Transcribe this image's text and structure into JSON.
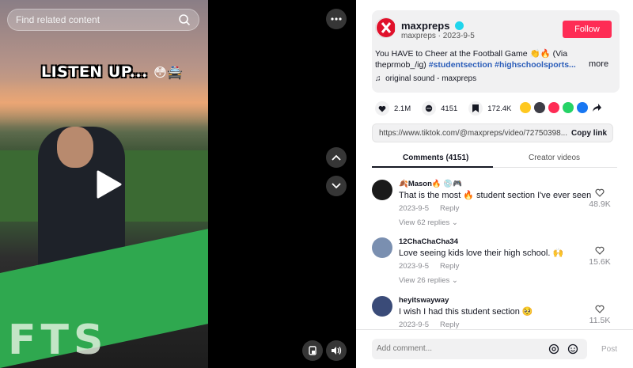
{
  "video": {
    "search_placeholder": "Find related content",
    "caption": "LISTEN UP...",
    "caption_emojis": "😳🚔",
    "banner_text": "FTS"
  },
  "author": {
    "handle": "maxpreps",
    "subline": "maxpreps · 2023-9-5",
    "follow_label": "Follow"
  },
  "post": {
    "text_start": "You HAVE to Cheer at the Football Game 👏🔥 (Via ",
    "text_source": "theprmob_/ig) ",
    "tags": "#studentsection #highschoolsports...",
    "more_label": "more",
    "sound": "original sound - maxpreps"
  },
  "stats": {
    "likes": "2.1M",
    "comments": "4151",
    "saves": "172.4K"
  },
  "share": {
    "url": "https://www.tiktok.com/@maxpreps/video/72750398...",
    "copy_label": "Copy link"
  },
  "tabs": {
    "comments": "Comments (4151)",
    "creator": "Creator videos"
  },
  "comments": [
    {
      "name": "🍂Mason🔥 💿🎮",
      "text": "That is the most 🔥 student section I've ever seen",
      "date": "2023-9-5",
      "reply": "Reply",
      "views": "View 62 replies ⌄",
      "likes": "48.9K"
    },
    {
      "name": "12ChaChaCha34",
      "text": "Love seeing kids love their high school. 🙌",
      "date": "2023-9-5",
      "reply": "Reply",
      "views": "View 26 replies ⌄",
      "likes": "15.6K"
    },
    {
      "name": "heyitswayway",
      "text": "I wish I had this student section 🥺",
      "date": "2023-9-5",
      "reply": "Reply",
      "views": "",
      "likes": "11.5K"
    }
  ],
  "footer": {
    "add_placeholder": "Add comment...",
    "post_label": "Post"
  },
  "colors": {
    "accent": "#fe2c55",
    "tag": "#2b5db9",
    "banner": "#2fa84f"
  }
}
